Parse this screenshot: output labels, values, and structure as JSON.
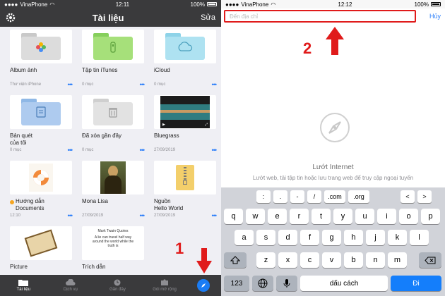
{
  "left": {
    "status": {
      "carrier": "VinaPhone",
      "time": "12:11",
      "battery": "100%"
    },
    "title": "Tài liệu",
    "edit": "Sửa",
    "items": [
      {
        "name": "Album ảnh",
        "meta": "Thư viện iPhone",
        "icon": "photos-folder-icon"
      },
      {
        "name": "Tập tin iTunes",
        "meta": "0 mục",
        "icon": "itunes-folder-icon"
      },
      {
        "name": "iCloud",
        "meta": "0 mục",
        "icon": "icloud-folder-icon"
      },
      {
        "name": "Bản quét\ncủa tôi",
        "meta": "0 mục",
        "icon": "scan-folder-icon"
      },
      {
        "name": "Đã xóa gần đây",
        "meta": "0 mục",
        "icon": "trash-folder-icon"
      },
      {
        "name": "Bluegrass",
        "meta": "27/09/2019",
        "icon": "video-thumbnail"
      },
      {
        "name": "Hướng dẫn\nDocuments",
        "meta": "12:10",
        "icon": "lifebuoy-icon"
      },
      {
        "name": "Mona Lisa",
        "meta": "27/09/2019",
        "icon": "mona-lisa-thumbnail"
      },
      {
        "name": "Nguồn\nHello World",
        "meta": "27/09/2019",
        "icon": "zip-file-icon"
      },
      {
        "name": "Picture",
        "meta": "",
        "icon": "picture-thumbnail"
      },
      {
        "name": "Trích dẫn",
        "meta": "",
        "icon": "quotes-thumbnail"
      }
    ],
    "quote_title": "Mark Twain Quotes",
    "quote_text": "A lie can travel half way around the world while the truth is",
    "tabs": [
      {
        "label": "Tài liệu",
        "icon": "folder-icon"
      },
      {
        "label": "Dịch vụ",
        "icon": "cloud-icon"
      },
      {
        "label": "Gần đây",
        "icon": "clock-icon"
      },
      {
        "label": "Gói mở rộng",
        "icon": "puzzle-icon"
      }
    ],
    "annotation": "1"
  },
  "right": {
    "status": {
      "carrier": "VinaPhone",
      "time": "12:12",
      "battery": "100%"
    },
    "address_placeholder": "Đến địa chỉ",
    "cancel": "Hủy",
    "annotation": "2",
    "browse_title": "Lướt Internet",
    "browse_desc": "Lướt web, tải tập tin hoặc lưu trang web để truy cập ngoại tuyến",
    "shortcuts": [
      ":",
      ".",
      "-",
      "/",
      ".com",
      ".org",
      "<",
      ">"
    ],
    "row1": [
      "q",
      "w",
      "e",
      "r",
      "t",
      "y",
      "u",
      "i",
      "o",
      "p"
    ],
    "row2": [
      "a",
      "s",
      "d",
      "f",
      "g",
      "h",
      "j",
      "k",
      "l"
    ],
    "row3": [
      "z",
      "x",
      "c",
      "v",
      "b",
      "n",
      "m"
    ],
    "key_123": "123",
    "space": "dấu cách",
    "go": "Đi"
  },
  "colors": {
    "accent": "#2d7ff9",
    "annotation": "#e01b1b",
    "dark_bar": "#3a3a3c"
  }
}
